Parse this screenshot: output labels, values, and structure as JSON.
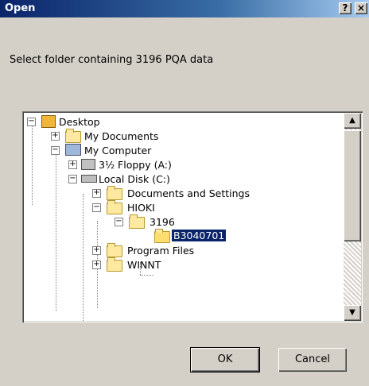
{
  "window": {
    "title": "Open",
    "help_label": "?",
    "close_label": "×"
  },
  "dialog": {
    "prompt": "Select folder containing 3196 PQA data"
  },
  "tree": {
    "desktop": "Desktop",
    "my_documents": "My Documents",
    "my_computer": "My Computer",
    "floppy": "3½ Floppy (A:)",
    "local_disk": "Local Disk (C:)",
    "docs_settings": "Documents and Settings",
    "hioki": "HIOKI",
    "f3196": "3196",
    "b3040701": "B3040701",
    "program_files": "Program Files",
    "winnt": "WINNT",
    "expander_plus": "+",
    "expander_minus": "−"
  },
  "buttons": {
    "ok": "OK",
    "cancel": "Cancel"
  },
  "scrollbar": {
    "up": "▲",
    "down": "▼"
  }
}
